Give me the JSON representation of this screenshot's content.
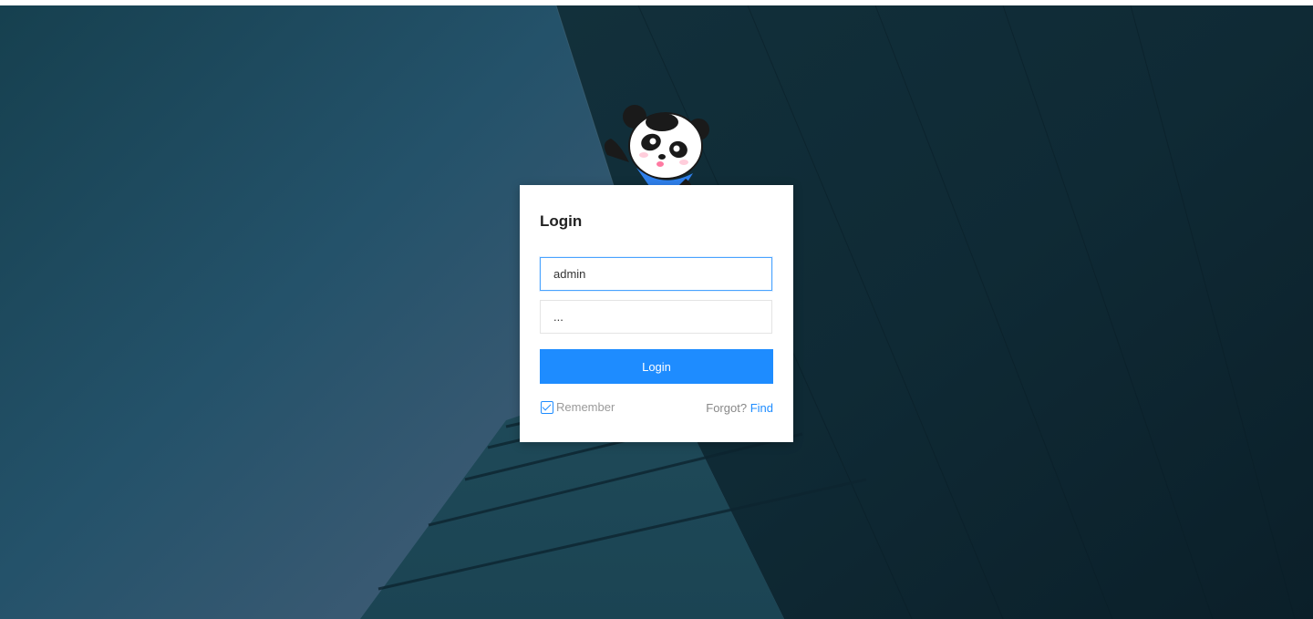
{
  "login": {
    "title": "Login",
    "username": {
      "value": "admin",
      "placeholder": ""
    },
    "password": {
      "value": "...",
      "placeholder": ""
    },
    "submit_label": "Login",
    "remember_label": "Remember",
    "remember_checked": true,
    "forgot_label": "Forgot?",
    "find_label": "Find"
  },
  "colors": {
    "accent": "#1e8cff",
    "card": "#ffffff",
    "background": "#1c4a5c"
  },
  "icons": {
    "mascot": "panda-mascot-icon",
    "checkbox": "checkbox-checked-icon"
  }
}
